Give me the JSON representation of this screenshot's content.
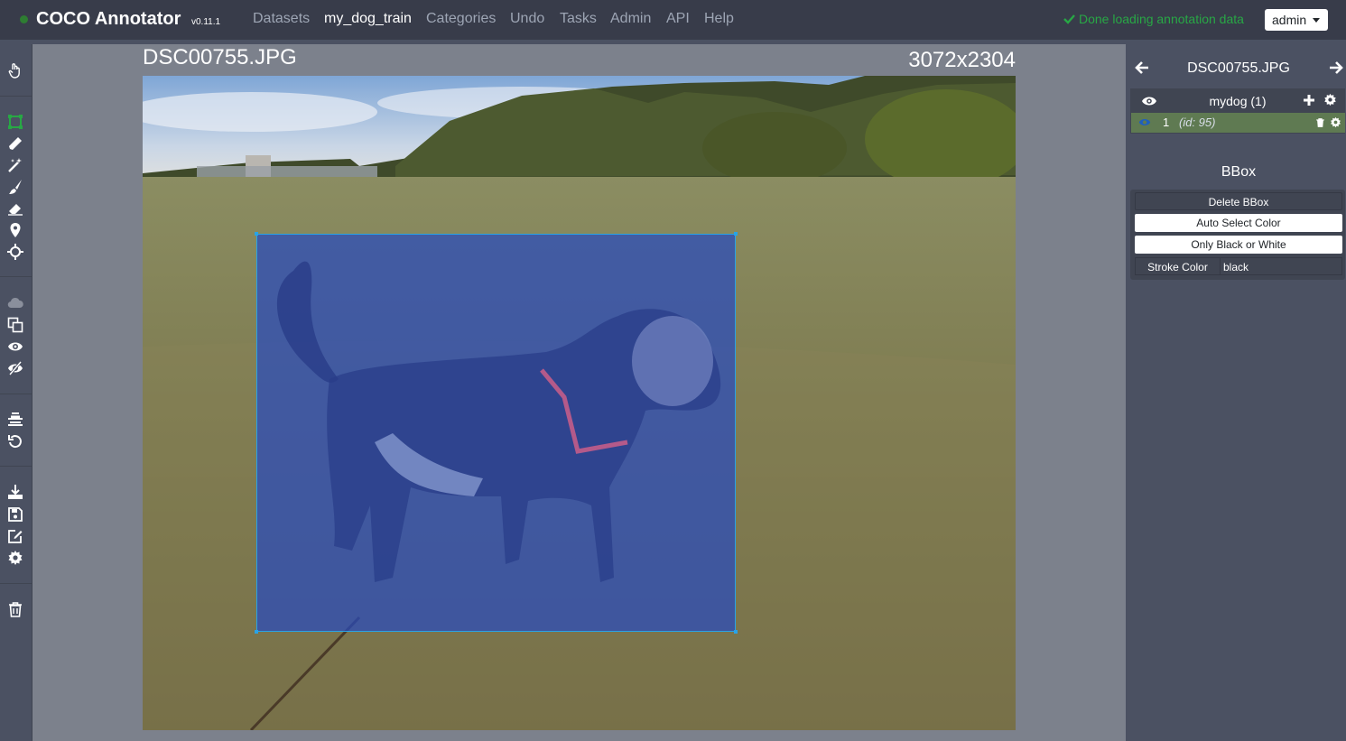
{
  "app": {
    "brand": "COCO Annotator",
    "version": "v0.11.1",
    "nav": [
      "Datasets",
      "my_dog_train",
      "Categories",
      "Undo",
      "Tasks",
      "Admin",
      "API",
      "Help"
    ],
    "active_nav": "my_dog_train",
    "status": "Done loading annotation data",
    "user": "admin"
  },
  "toolbar": {
    "groups": [
      [
        "hand-icon"
      ],
      [
        "bbox-icon",
        "polygon-icon",
        "magic-wand-icon",
        "brush-icon",
        "eraser-icon",
        "keypoint-icon",
        "move-icon"
      ],
      [
        "cloud-icon",
        "copy-icon",
        "show-all-icon",
        "hide-all-icon"
      ],
      [
        "layers-icon",
        "undo-icon"
      ],
      [
        "download-icon",
        "save-icon",
        "edit-icon",
        "settings-icon"
      ],
      [
        "trash-icon"
      ]
    ],
    "active_tool": "bbox-icon"
  },
  "canvas": {
    "filename": "DSC00755.JPG",
    "dimensions": "3072x2304"
  },
  "sidebar": {
    "filename": "DSC00755.JPG",
    "category": "mydog (1)",
    "annotation": {
      "index": "1",
      "id_label": "(id: 95)"
    },
    "panel_title": "BBox",
    "buttons": [
      "Delete BBox",
      "Auto Select Color",
      "Only Black or White"
    ],
    "stroke_color_label": "Stroke Color",
    "stroke_color_value": "black"
  },
  "colors": {
    "navbar": "#383c4a",
    "panel": "#4b5162",
    "status_green": "#28a745",
    "bbox_fill": "#284bbe",
    "bbox_stroke": "#29a3e6",
    "annotation_row": "#5f7a52"
  }
}
